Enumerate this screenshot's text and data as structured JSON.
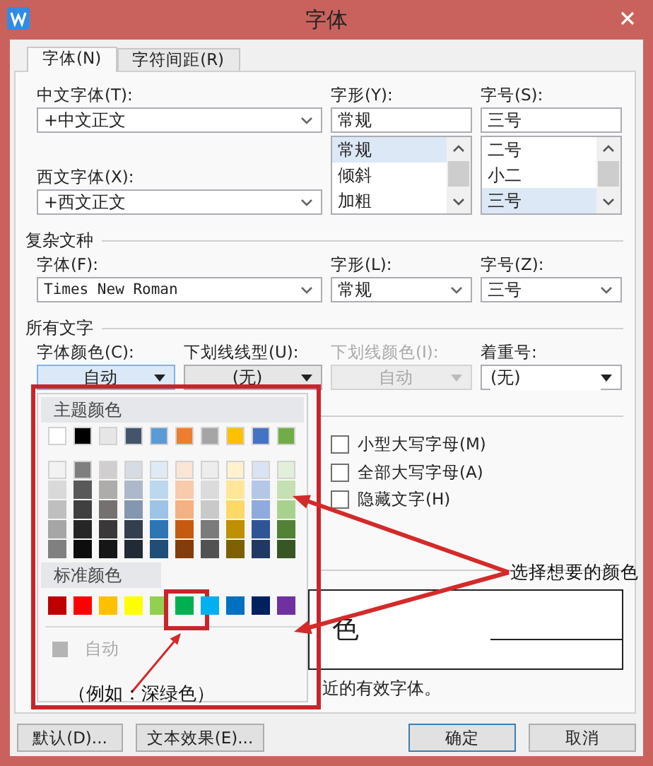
{
  "window": {
    "title": "字体"
  },
  "tabs": [
    {
      "label": "字体(N)",
      "selected": true
    },
    {
      "label": "字符间距(R)",
      "selected": false
    }
  ],
  "chinese_font": {
    "label": "中文字体(T):",
    "value": "+中文正文"
  },
  "western_font": {
    "label": "西文字体(X):",
    "value": "+西文正文"
  },
  "style": {
    "label": "字形(Y):",
    "value": "常规",
    "options": [
      {
        "label": "常规",
        "selected": true
      },
      {
        "label": "倾斜",
        "selected": false
      },
      {
        "label": "加粗",
        "selected": false
      }
    ]
  },
  "size": {
    "label": "字号(S):",
    "value": "三号",
    "options": [
      {
        "label": "二号",
        "selected": false
      },
      {
        "label": "小二",
        "selected": false
      },
      {
        "label": "三号",
        "selected": true
      }
    ]
  },
  "complex_script": {
    "heading": "复杂文种",
    "fields": [
      {
        "label": "字体(F):",
        "value": "Times New Roman"
      },
      {
        "label": "字形(L):",
        "value": "常规"
      },
      {
        "label": "字号(Z):",
        "value": "三号"
      }
    ]
  },
  "all_text": {
    "heading": "所有文字",
    "fields": [
      {
        "label": "字体颜色(C):",
        "value": "自动",
        "kind": "picker",
        "open": true,
        "disabled": false
      },
      {
        "label": "下划线线型(U):",
        "value": "(无)",
        "kind": "picker",
        "open": false,
        "disabled": false
      },
      {
        "label": "下划线颜色(I):",
        "value": "自动",
        "kind": "picker",
        "open": false,
        "disabled": true
      },
      {
        "label": "着重号:",
        "value": "(无)",
        "kind": "select",
        "open": false,
        "disabled": false
      }
    ]
  },
  "effects": [
    {
      "label": "小型大写字母(M)",
      "checked": false
    },
    {
      "label": "全部大写字母(A)",
      "checked": false
    },
    {
      "label": "隐藏文字(H)",
      "checked": false
    }
  ],
  "preview": {
    "text": "色",
    "note": "近的有效字体。"
  },
  "buttons": [
    {
      "label": "默认(D)...",
      "default": false
    },
    {
      "label": "文本效果(E)...",
      "default": false
    },
    {
      "label": "确定",
      "default": true
    },
    {
      "label": "取消",
      "default": false
    }
  ],
  "color_popup": {
    "theme_heading": "主题颜色",
    "theme_colors": [
      {
        "color": "#ffffff"
      },
      {
        "color": "#000000"
      },
      {
        "color": "#e7e6e6"
      },
      {
        "color": "#44546a"
      },
      {
        "color": "#5b9bd5"
      },
      {
        "color": "#ed7d31"
      },
      {
        "color": "#a5a5a5"
      },
      {
        "color": "#ffc000"
      },
      {
        "color": "#4472c4"
      },
      {
        "color": "#70ad47"
      }
    ],
    "shades": [
      [
        {
          "color": "#f2f2f2"
        },
        {
          "color": "#7f7f7f"
        },
        {
          "color": "#d0cece"
        },
        {
          "color": "#d6dce4"
        },
        {
          "color": "#deebf6"
        },
        {
          "color": "#fbe5d5"
        },
        {
          "color": "#ededed"
        },
        {
          "color": "#fff2cc"
        },
        {
          "color": "#dae3f3"
        },
        {
          "color": "#e2f0d9"
        }
      ],
      [
        {
          "color": "#d9d9d9"
        },
        {
          "color": "#595959"
        },
        {
          "color": "#aeabab"
        },
        {
          "color": "#adb9ca"
        },
        {
          "color": "#bdd7ee"
        },
        {
          "color": "#f7cbac"
        },
        {
          "color": "#dbdbdb"
        },
        {
          "color": "#ffe699"
        },
        {
          "color": "#b4c7e7"
        },
        {
          "color": "#c5e0b4"
        }
      ],
      [
        {
          "color": "#bfbfbf"
        },
        {
          "color": "#404040"
        },
        {
          "color": "#757171"
        },
        {
          "color": "#8497b0"
        },
        {
          "color": "#9dc3e6"
        },
        {
          "color": "#f4b183"
        },
        {
          "color": "#c9c9c9"
        },
        {
          "color": "#ffd966"
        },
        {
          "color": "#8faadc"
        },
        {
          "color": "#a9d18e"
        }
      ],
      [
        {
          "color": "#a6a6a6"
        },
        {
          "color": "#262626"
        },
        {
          "color": "#3a3838"
        },
        {
          "color": "#333f4f"
        },
        {
          "color": "#2e75b5"
        },
        {
          "color": "#c55a11"
        },
        {
          "color": "#7b7b7b"
        },
        {
          "color": "#bf9000"
        },
        {
          "color": "#2f5597"
        },
        {
          "color": "#538135"
        }
      ],
      [
        {
          "color": "#808080"
        },
        {
          "color": "#0d0d0d"
        },
        {
          "color": "#171616"
        },
        {
          "color": "#222a35"
        },
        {
          "color": "#1f4e79"
        },
        {
          "color": "#833c0b"
        },
        {
          "color": "#525252"
        },
        {
          "color": "#7f6000"
        },
        {
          "color": "#203864"
        },
        {
          "color": "#375623"
        }
      ]
    ],
    "standard_heading": "标准颜色",
    "standard_colors": [
      {
        "color": "#c00000",
        "selected": false
      },
      {
        "color": "#ff0000",
        "selected": false
      },
      {
        "color": "#ffc000",
        "selected": false
      },
      {
        "color": "#ffff00",
        "selected": false
      },
      {
        "color": "#92d050",
        "selected": false
      },
      {
        "color": "#00b050",
        "selected": true
      },
      {
        "color": "#00b0f0",
        "selected": false
      },
      {
        "color": "#0070c0",
        "selected": false
      },
      {
        "color": "#002060",
        "selected": false
      },
      {
        "color": "#7030a0",
        "selected": false
      }
    ],
    "auto_label": "自动"
  },
  "annotations": {
    "callout": "选择想要的颜色",
    "example": "（例如：深绿色）"
  }
}
